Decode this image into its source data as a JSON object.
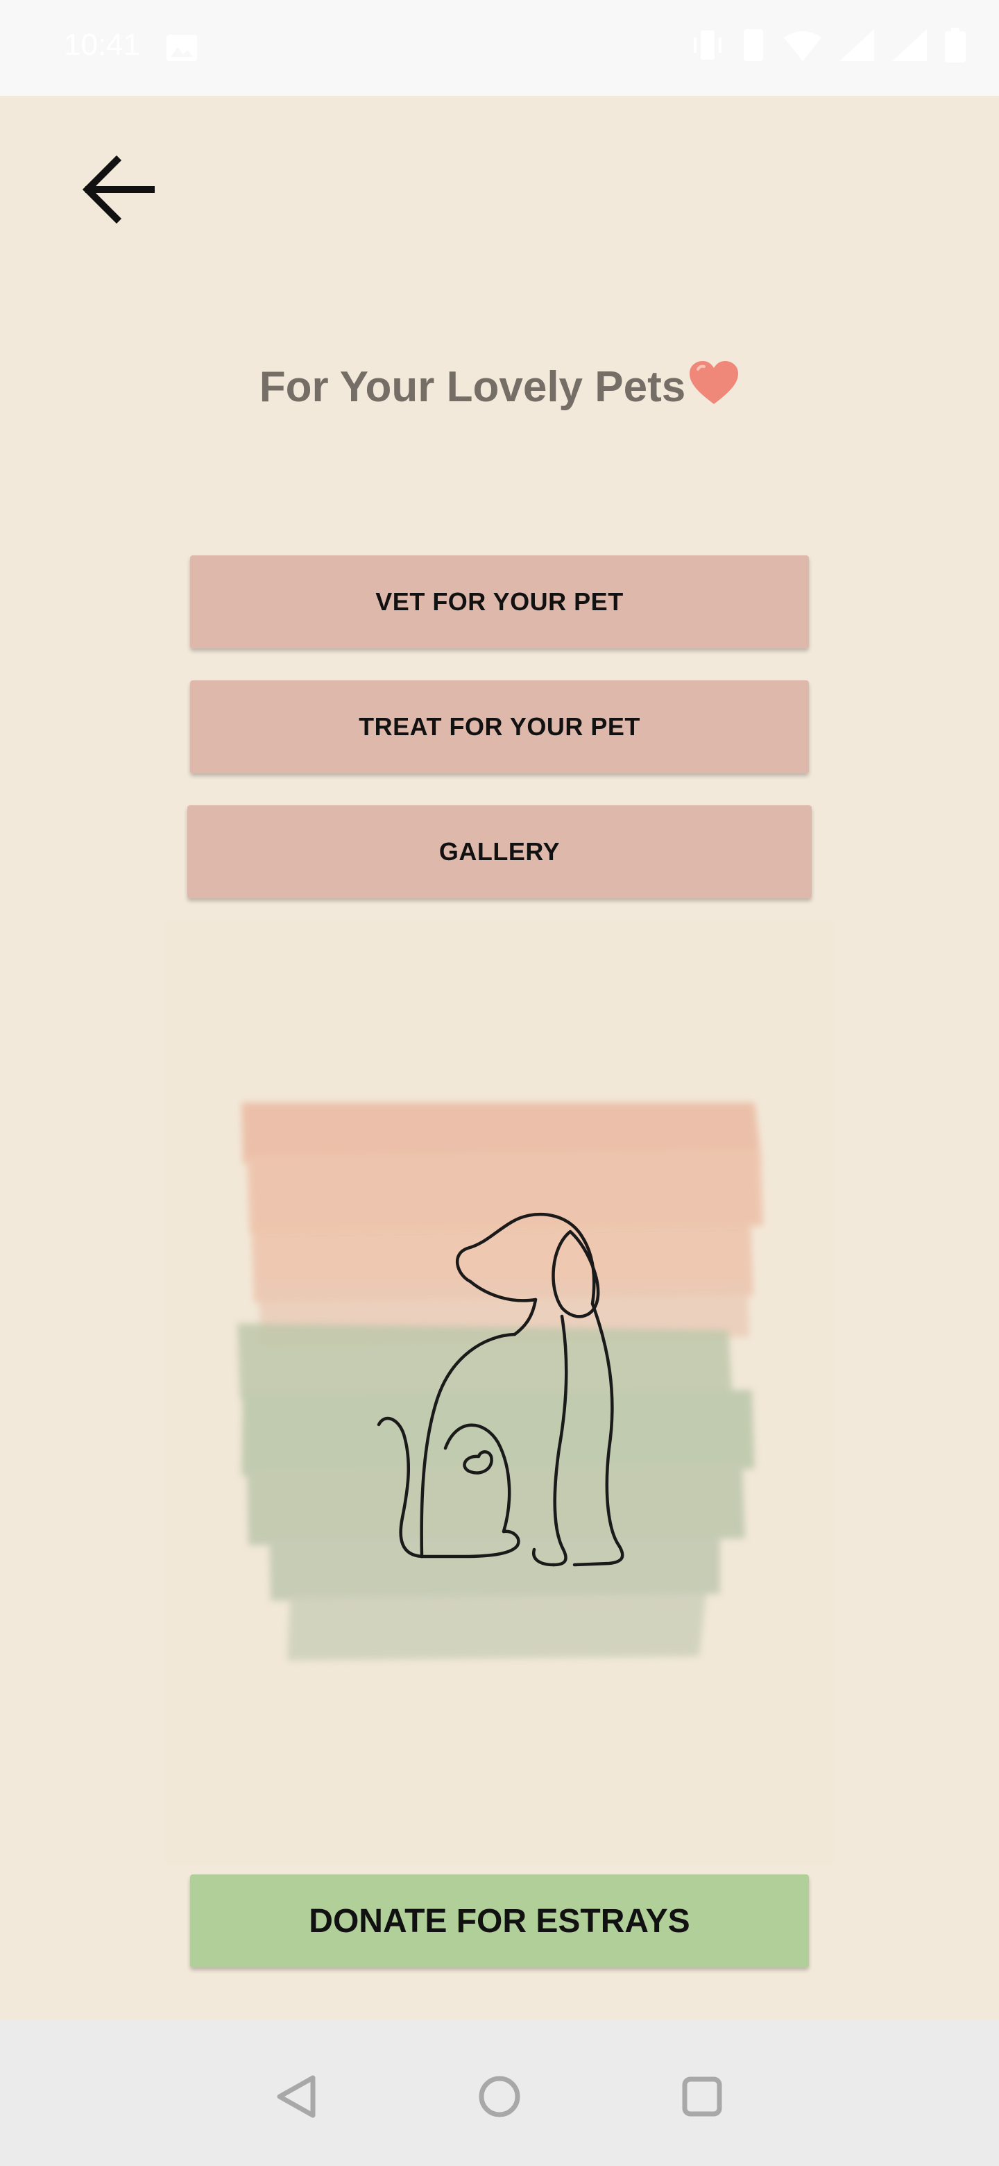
{
  "status_bar": {
    "time": "10:41",
    "icons": [
      "gallery-icon",
      "vibrate-icon",
      "wifi-icon",
      "signal-icon",
      "signal-icon",
      "battery-icon"
    ]
  },
  "header": {
    "back_icon": "arrow-left-icon"
  },
  "title": {
    "text": "For Your Lovely Pets",
    "emoji": "heart-icon",
    "color": "#756e66"
  },
  "menu": {
    "vet_label": "VET FOR YOUR PET",
    "treat_label": "TREAT FOR YOUR PET",
    "gallery_label": "GALLERY",
    "button_color": "#dfb8ac"
  },
  "illustration": {
    "subject": "dog-line-art-icon",
    "colors": [
      "#eab9a1",
      "#b9c6a9"
    ]
  },
  "donate": {
    "label": "DONATE FOR ESTRAYS",
    "color": "#b1cf98"
  },
  "nav_bar": {
    "icons": [
      "nav-back-icon",
      "nav-home-icon",
      "nav-recents-icon"
    ]
  },
  "colors": {
    "background": "#f3e9da"
  }
}
